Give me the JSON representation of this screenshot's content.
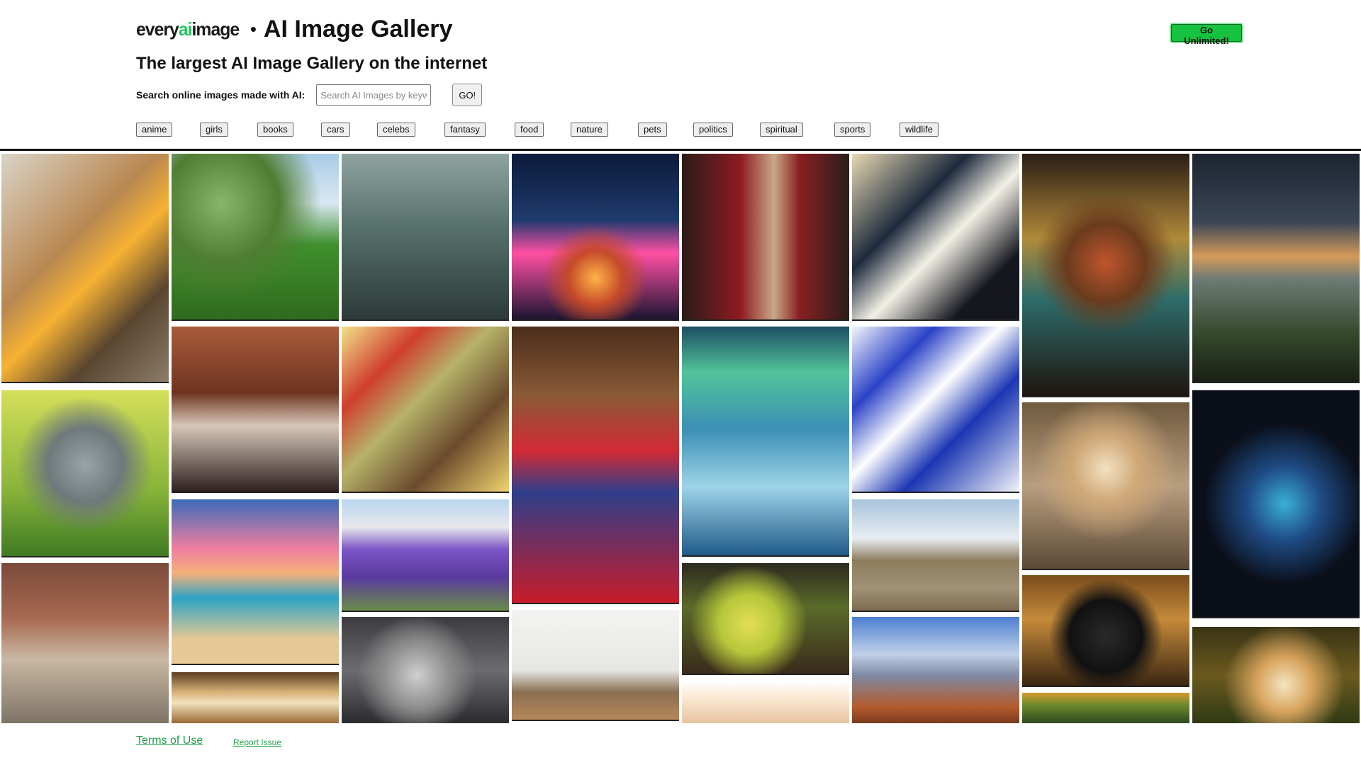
{
  "brand": {
    "logo_prefix": "every",
    "logo_ai": "ai",
    "logo_suffix": "image",
    "separator": "•",
    "title": "AI Image Gallery"
  },
  "tagline": "The largest AI Image Gallery on the internet",
  "search": {
    "label": "Search online images made with AI:",
    "placeholder": "Search AI Images by keyword",
    "value": "",
    "button_label": "GO!"
  },
  "unlimited_button": "Go Unlimited!",
  "tags": [
    "anime",
    "girls",
    "books",
    "cars",
    "celebs",
    "fantasy",
    "food",
    "nature",
    "pets",
    "politics",
    "spiritual",
    "sports",
    "wildlife"
  ],
  "footer": {
    "terms": "Terms of Use",
    "report": "Report Issue"
  },
  "colors": {
    "accent": "#16c23f",
    "link": "#22a04b",
    "divider": "#111111"
  }
}
